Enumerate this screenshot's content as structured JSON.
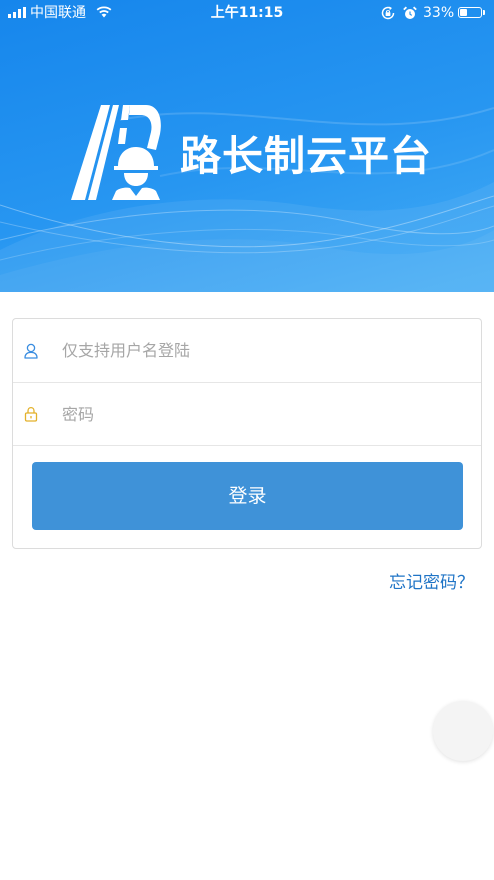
{
  "status_bar": {
    "carrier": "中国联通",
    "time": "上午11:15",
    "battery_percent": "33%",
    "battery_level": 0.33,
    "icons": [
      "signal-icon",
      "wifi-icon",
      "rotation-lock-icon",
      "alarm-icon",
      "battery-icon"
    ]
  },
  "header": {
    "logo_icon": "road-worker-logo-icon",
    "title": "路长制云平台"
  },
  "login_form": {
    "username": {
      "icon": "user-icon",
      "placeholder": "仅支持用户名登陆",
      "value": ""
    },
    "password": {
      "icon": "lock-icon",
      "placeholder": "密码",
      "value": ""
    },
    "submit_label": "登录"
  },
  "forgot_password_label": "忘记密码？",
  "floating_button": {
    "icon": "assistive-touch-icon"
  },
  "colors": {
    "header_top": "#1686ec",
    "header_mid": "#2796f1",
    "header_bottom": "#44acf5",
    "button": "#3f92d8",
    "link": "#1f74c6",
    "user_icon": "#3a8de0",
    "lock_icon": "#e3b12a"
  }
}
